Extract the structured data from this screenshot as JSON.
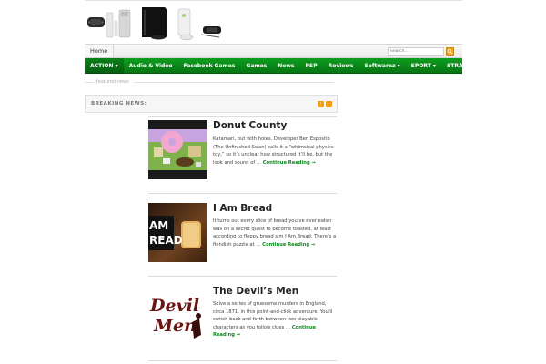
{
  "nav": {
    "home": "Home",
    "search_placeholder": "Search...",
    "categories": [
      "ACTION ▾",
      "Audio & Video",
      "Facebook Games",
      "Games",
      "News",
      "PSP",
      "Reviews",
      "Softwarez ▾",
      "SPORT ▾",
      "STRATEGY ▾"
    ]
  },
  "featured_label": "featured news",
  "breaking": {
    "label": "BREAKING NEWS:",
    "prev": "‹",
    "next": "›"
  },
  "articles": [
    {
      "title": "Donut County",
      "excerpt": "Katamari, but with holes. Developer Ben Esposito (The Unfinished Swan) calls it a “whimsical physics toy,” so it’s unclear how structured it’ll be, but the look and sound of …",
      "more": "Continue Reading →"
    },
    {
      "title": "I Am Bread",
      "excerpt": "It turns out every slice of bread you’ve ever eaten was on a secret quest to become toasted, at least according to floppy bread sim I Am Bread. There’s a fiendish puzzle at …",
      "more": "Continue Reading →",
      "thumb_text": "AM\nREAD"
    },
    {
      "title": "The Devil’s Men",
      "excerpt": "Solve a series of gruesome murders in England, circa 1871, in this point-and-click adventure. You’ll switch back and forth between two playable characters as you follow clues …",
      "more": "Continue Reading →"
    }
  ],
  "colors": {
    "nav_green": "#0a8a1a",
    "accent_orange": "#f39c12",
    "link_green": "#0b8a1b"
  }
}
